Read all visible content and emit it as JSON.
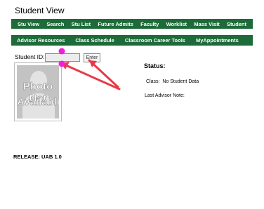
{
  "page": {
    "title": "Student View"
  },
  "nav_primary": [
    "Stu View",
    "Search",
    "Stu List",
    "Future Admits",
    "Faculty",
    "Worklist",
    "Mass Visit",
    "Student"
  ],
  "nav_secondary": [
    "Advisor Resources",
    "Class Schedule",
    "Classroom Career Tools",
    "MyAppointments"
  ],
  "student_id": {
    "label": "Student ID:",
    "value": "",
    "button": "Enter"
  },
  "photo": {
    "line1": "Photo Not",
    "line2": "Available"
  },
  "status": {
    "heading": "Status:",
    "class_label": "Class:",
    "class_value": "No Student Data",
    "advisor_note_label": "Last Advisor Note:"
  },
  "footer": {
    "release": "RELEASE: UAB 1.0"
  },
  "annotation": {
    "arrow_color": "#e83a4a",
    "dot_color": "#ee20d8"
  }
}
